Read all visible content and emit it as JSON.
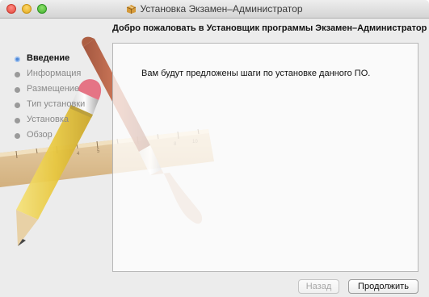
{
  "window": {
    "title": "Установка Экзамен–Администратор",
    "title_icon": "package-icon",
    "traffic_lights": [
      "close",
      "minimize",
      "zoom"
    ]
  },
  "heading": "Добро пожаловать в Установщик программы Экзамен–Администратор",
  "steps": [
    {
      "label": "Введение",
      "active": true
    },
    {
      "label": "Информация",
      "active": false
    },
    {
      "label": "Размещение",
      "active": false
    },
    {
      "label": "Тип установки",
      "active": false
    },
    {
      "label": "Установка",
      "active": false
    },
    {
      "label": "Обзор",
      "active": false
    }
  ],
  "content": {
    "text": "Вам будут предложены шаги по установке данного ПО."
  },
  "buttons": {
    "back": {
      "label": "Назад",
      "enabled": false
    },
    "continue": {
      "label": "Продолжить",
      "enabled": true
    }
  },
  "colors": {
    "active_bullet": "#4f89d8",
    "inactive_step": "#8a8a8a"
  }
}
